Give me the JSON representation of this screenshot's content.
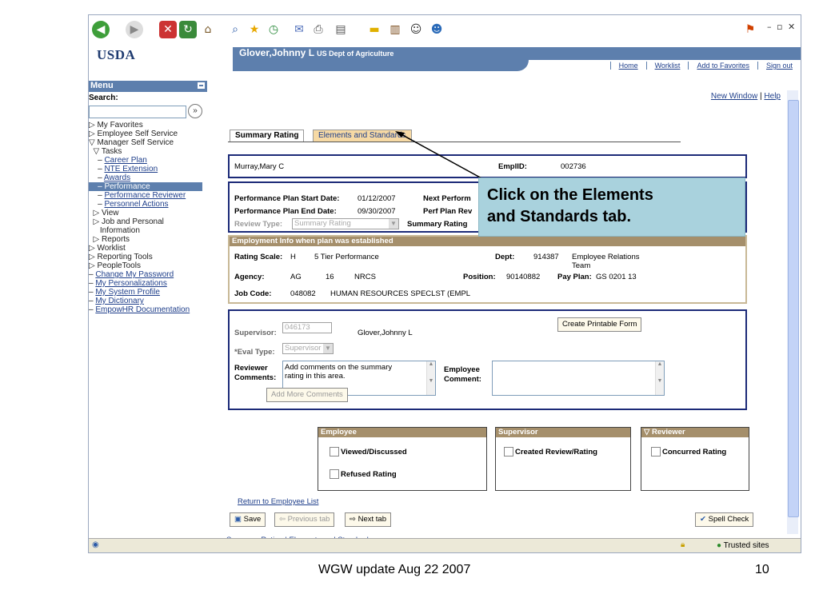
{
  "browser": {
    "toolbar_icons": [
      "back-icon",
      "forward-icon",
      "stop-icon",
      "refresh-icon",
      "home-icon",
      "search-icon",
      "favorites-icon",
      "history-icon",
      "mail-icon",
      "print-icon",
      "edit-icon",
      "discuss-icon",
      "research-icon",
      "messenger-icon",
      "users-icon"
    ],
    "window_controls": [
      "minimize",
      "restore",
      "close"
    ],
    "status_text": "Trusted sites"
  },
  "header": {
    "logo_text": "USDA",
    "user_name": "Glover,Johnny L",
    "user_org": "US Dept of Agriculture",
    "nav_links": [
      "Home",
      "Worklist",
      "Add to Favorites",
      "Sign out"
    ]
  },
  "menu": {
    "title": "Menu",
    "search_label": "Search:",
    "items": [
      {
        "label": "My Favorites",
        "prefix": "▷ "
      },
      {
        "label": "Employee Self Service",
        "prefix": "▷ "
      },
      {
        "label": "Manager Self Service",
        "prefix": "▽ "
      },
      {
        "label": "Tasks",
        "prefix": "  ▽ "
      },
      {
        "label": "Career Plan",
        "prefix": "    – ",
        "link": true
      },
      {
        "label": "NTE Extension",
        "prefix": "    – ",
        "link": true
      },
      {
        "label": "Awards",
        "prefix": "    – ",
        "link": true
      },
      {
        "label": "Performance",
        "prefix": "    – ",
        "selected": true
      },
      {
        "label": "Performance Reviewer",
        "prefix": "    – ",
        "link": true
      },
      {
        "label": "Personnel Actions",
        "prefix": "    – ",
        "link": true
      },
      {
        "label": "View",
        "prefix": "  ▷ "
      },
      {
        "label": "Job and Personal",
        "prefix": "  ▷ "
      },
      {
        "label": "Information",
        "prefix": "     "
      },
      {
        "label": "Reports",
        "prefix": "  ▷ "
      },
      {
        "label": "Worklist",
        "prefix": "▷ "
      },
      {
        "label": "Reporting Tools",
        "prefix": "▷ "
      },
      {
        "label": "PeopleTools",
        "prefix": "▷ "
      },
      {
        "label": "Change My Password",
        "prefix": "– ",
        "link": true
      },
      {
        "label": "My Personalizations",
        "prefix": "– ",
        "link": true
      },
      {
        "label": "My System Profile",
        "prefix": "– ",
        "link": true
      },
      {
        "label": "My Dictionary",
        "prefix": "– ",
        "link": true
      },
      {
        "label": "EmpowHR Documentation",
        "prefix": "– ",
        "link": true
      }
    ]
  },
  "content": {
    "top_links": [
      "New Window",
      "Help"
    ],
    "tabs": [
      "Summary Rating",
      "Elements and Standards"
    ],
    "employee": {
      "name": "Murray,Mary C",
      "emplid_label": "EmplID:",
      "emplid": "002736"
    },
    "plan": {
      "start_label": "Performance Plan Start Date:",
      "start": "01/12/2007",
      "end_label": "Performance Plan End Date:",
      "end": "09/30/2007",
      "next_label": "Next Perform",
      "perf_rev_label": "Perf Plan Rev",
      "review_type_label": "Review Type:",
      "review_type": "Summary Rating",
      "summary_rating_label": "Summary Rating"
    },
    "employment": {
      "header": "Employment Info when plan was established",
      "rating_scale_label": "Rating Scale:",
      "rating_scale_code": "H",
      "rating_scale": "5 Tier Performance",
      "dept_label": "Dept:",
      "dept_code": "914387",
      "dept_name_1": "Employee Relations",
      "dept_name_2": "Team",
      "agency_label": "Agency:",
      "agency_code": "AG",
      "agency_num": "16",
      "agency_name": "NRCS",
      "position_label": "Position:",
      "position": "90140882",
      "payplan_label": "Pay Plan:",
      "payplan": "GS  0201 13",
      "jobcode_label": "Job Code:",
      "jobcode": "048082",
      "job_title": "HUMAN RESOURCES SPECLST (EMPL"
    },
    "supervisor": {
      "label": "Supervisor:",
      "id": "046173",
      "name": "Glover,Johnny L",
      "create_form": "Create Printable Form",
      "eval_type_label": "*Eval Type:",
      "eval_type": "Supervisor",
      "reviewer_comments_label_1": "Reviewer",
      "reviewer_comments_label_2": "Comments:",
      "reviewer_comments": "Add comments on the summary rating in this area.",
      "employee_comment_label_1": "Employee",
      "employee_comment_label_2": "Comment:",
      "add_more": "Add More Comments"
    },
    "ack": {
      "employee_header": "Employee",
      "supervisor_header": "Supervisor",
      "reviewer_header": "Reviewer",
      "viewed": "Viewed/Discussed",
      "refused": "Refused Rating",
      "created": "Created Review/Rating",
      "concurred": "Concurred Rating"
    },
    "return_link": "Return to Employee List",
    "buttons": {
      "save": "Save",
      "previous": "Previous tab",
      "next": "Next tab",
      "spell": "Spell Check"
    },
    "bottom_links": [
      "Summary Rating",
      "Elements and Standards"
    ]
  },
  "callout": {
    "text_line1": "Click on the Elements",
    "text_line2": "and Standards tab."
  },
  "slide_footer": {
    "text": "WGW update Aug 22 2007",
    "page": "10"
  },
  "colors": {
    "header_blue": "#5d7fad",
    "box_border": "#1c2a78",
    "callout_bg": "#a9d2dd",
    "brown": "#a58f6b"
  }
}
